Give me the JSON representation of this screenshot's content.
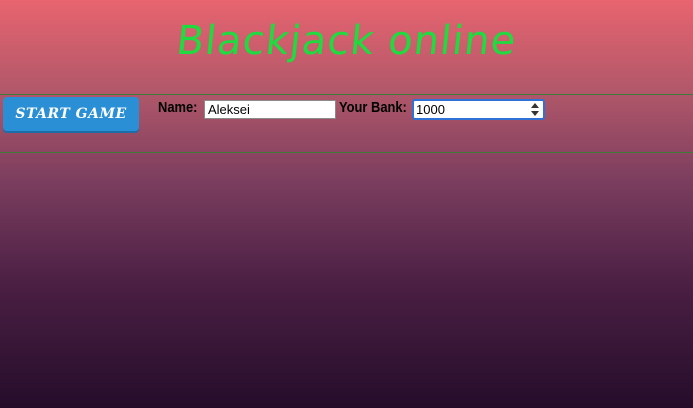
{
  "header": {
    "title": "Blackjack online"
  },
  "controls": {
    "start_button_label": "START GAME",
    "name_label": "Name:",
    "name_value": "Aleksei",
    "bank_label": "Your Bank:",
    "bank_value": "1000"
  },
  "colors": {
    "title": "#1edb3f",
    "start_button": "#2a8fd4",
    "divider": "#3f7a3a",
    "focus_ring": "#2f72d6"
  },
  "icons": {
    "bank_spinner": "number-spinner-icon"
  }
}
